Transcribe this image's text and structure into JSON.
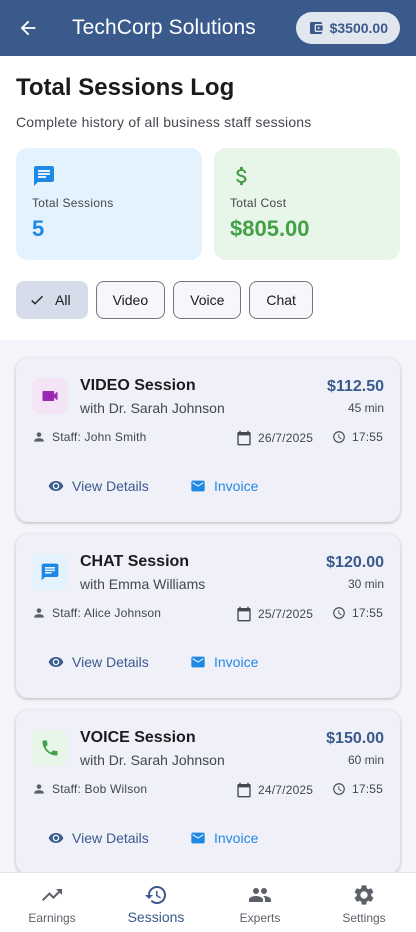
{
  "appbar": {
    "title": "TechCorp Solutions",
    "balance": "$3500.00"
  },
  "header": {
    "title": "Total Sessions Log",
    "subtitle": "Complete history of all business staff sessions"
  },
  "stats": {
    "sessions_label": "Total Sessions",
    "sessions_value": "5",
    "cost_label": "Total Cost",
    "cost_value": "$805.00"
  },
  "filters": [
    {
      "label": "All",
      "selected": true
    },
    {
      "label": "Video",
      "selected": false
    },
    {
      "label": "Voice",
      "selected": false
    },
    {
      "label": "Chat",
      "selected": false
    }
  ],
  "sessions": [
    {
      "type": "VIDEO Session",
      "with": "with Dr. Sarah Johnson",
      "price": "$112.50",
      "duration": "45 min",
      "staff": "Staff: John Smith",
      "date": "26/7/2025",
      "time": "17:55",
      "icon": "videocam-icon",
      "tile_color": "#f3e5f5",
      "icon_color": "#9c27b0"
    },
    {
      "type": "CHAT Session",
      "with": "with Emma Williams",
      "price": "$120.00",
      "duration": "30 min",
      "staff": "Staff: Alice Johnson",
      "date": "25/7/2025",
      "time": "17:55",
      "icon": "chat-icon",
      "tile_color": "#e3f2fd",
      "icon_color": "#1e88e5"
    },
    {
      "type": "VOICE Session",
      "with": "with Dr. Sarah Johnson",
      "price": "$150.00",
      "duration": "60 min",
      "staff": "Staff: Bob Wilson",
      "date": "24/7/2025",
      "time": "17:55",
      "icon": "phone-icon",
      "tile_color": "#e8f5e9",
      "icon_color": "#43a047"
    }
  ],
  "actions": {
    "view": "View Details",
    "invoice": "Invoice"
  },
  "nav": [
    {
      "label": "Earnings",
      "icon": "trending-up-icon",
      "active": false
    },
    {
      "label": "Sessions",
      "icon": "history-icon",
      "active": true
    },
    {
      "label": "Experts",
      "icon": "people-icon",
      "active": false
    },
    {
      "label": "Settings",
      "icon": "gear-icon",
      "active": false
    }
  ],
  "colors": {
    "primary": "#3a5a8c",
    "accent_blue": "#1e88e5",
    "accent_green": "#43a047"
  }
}
